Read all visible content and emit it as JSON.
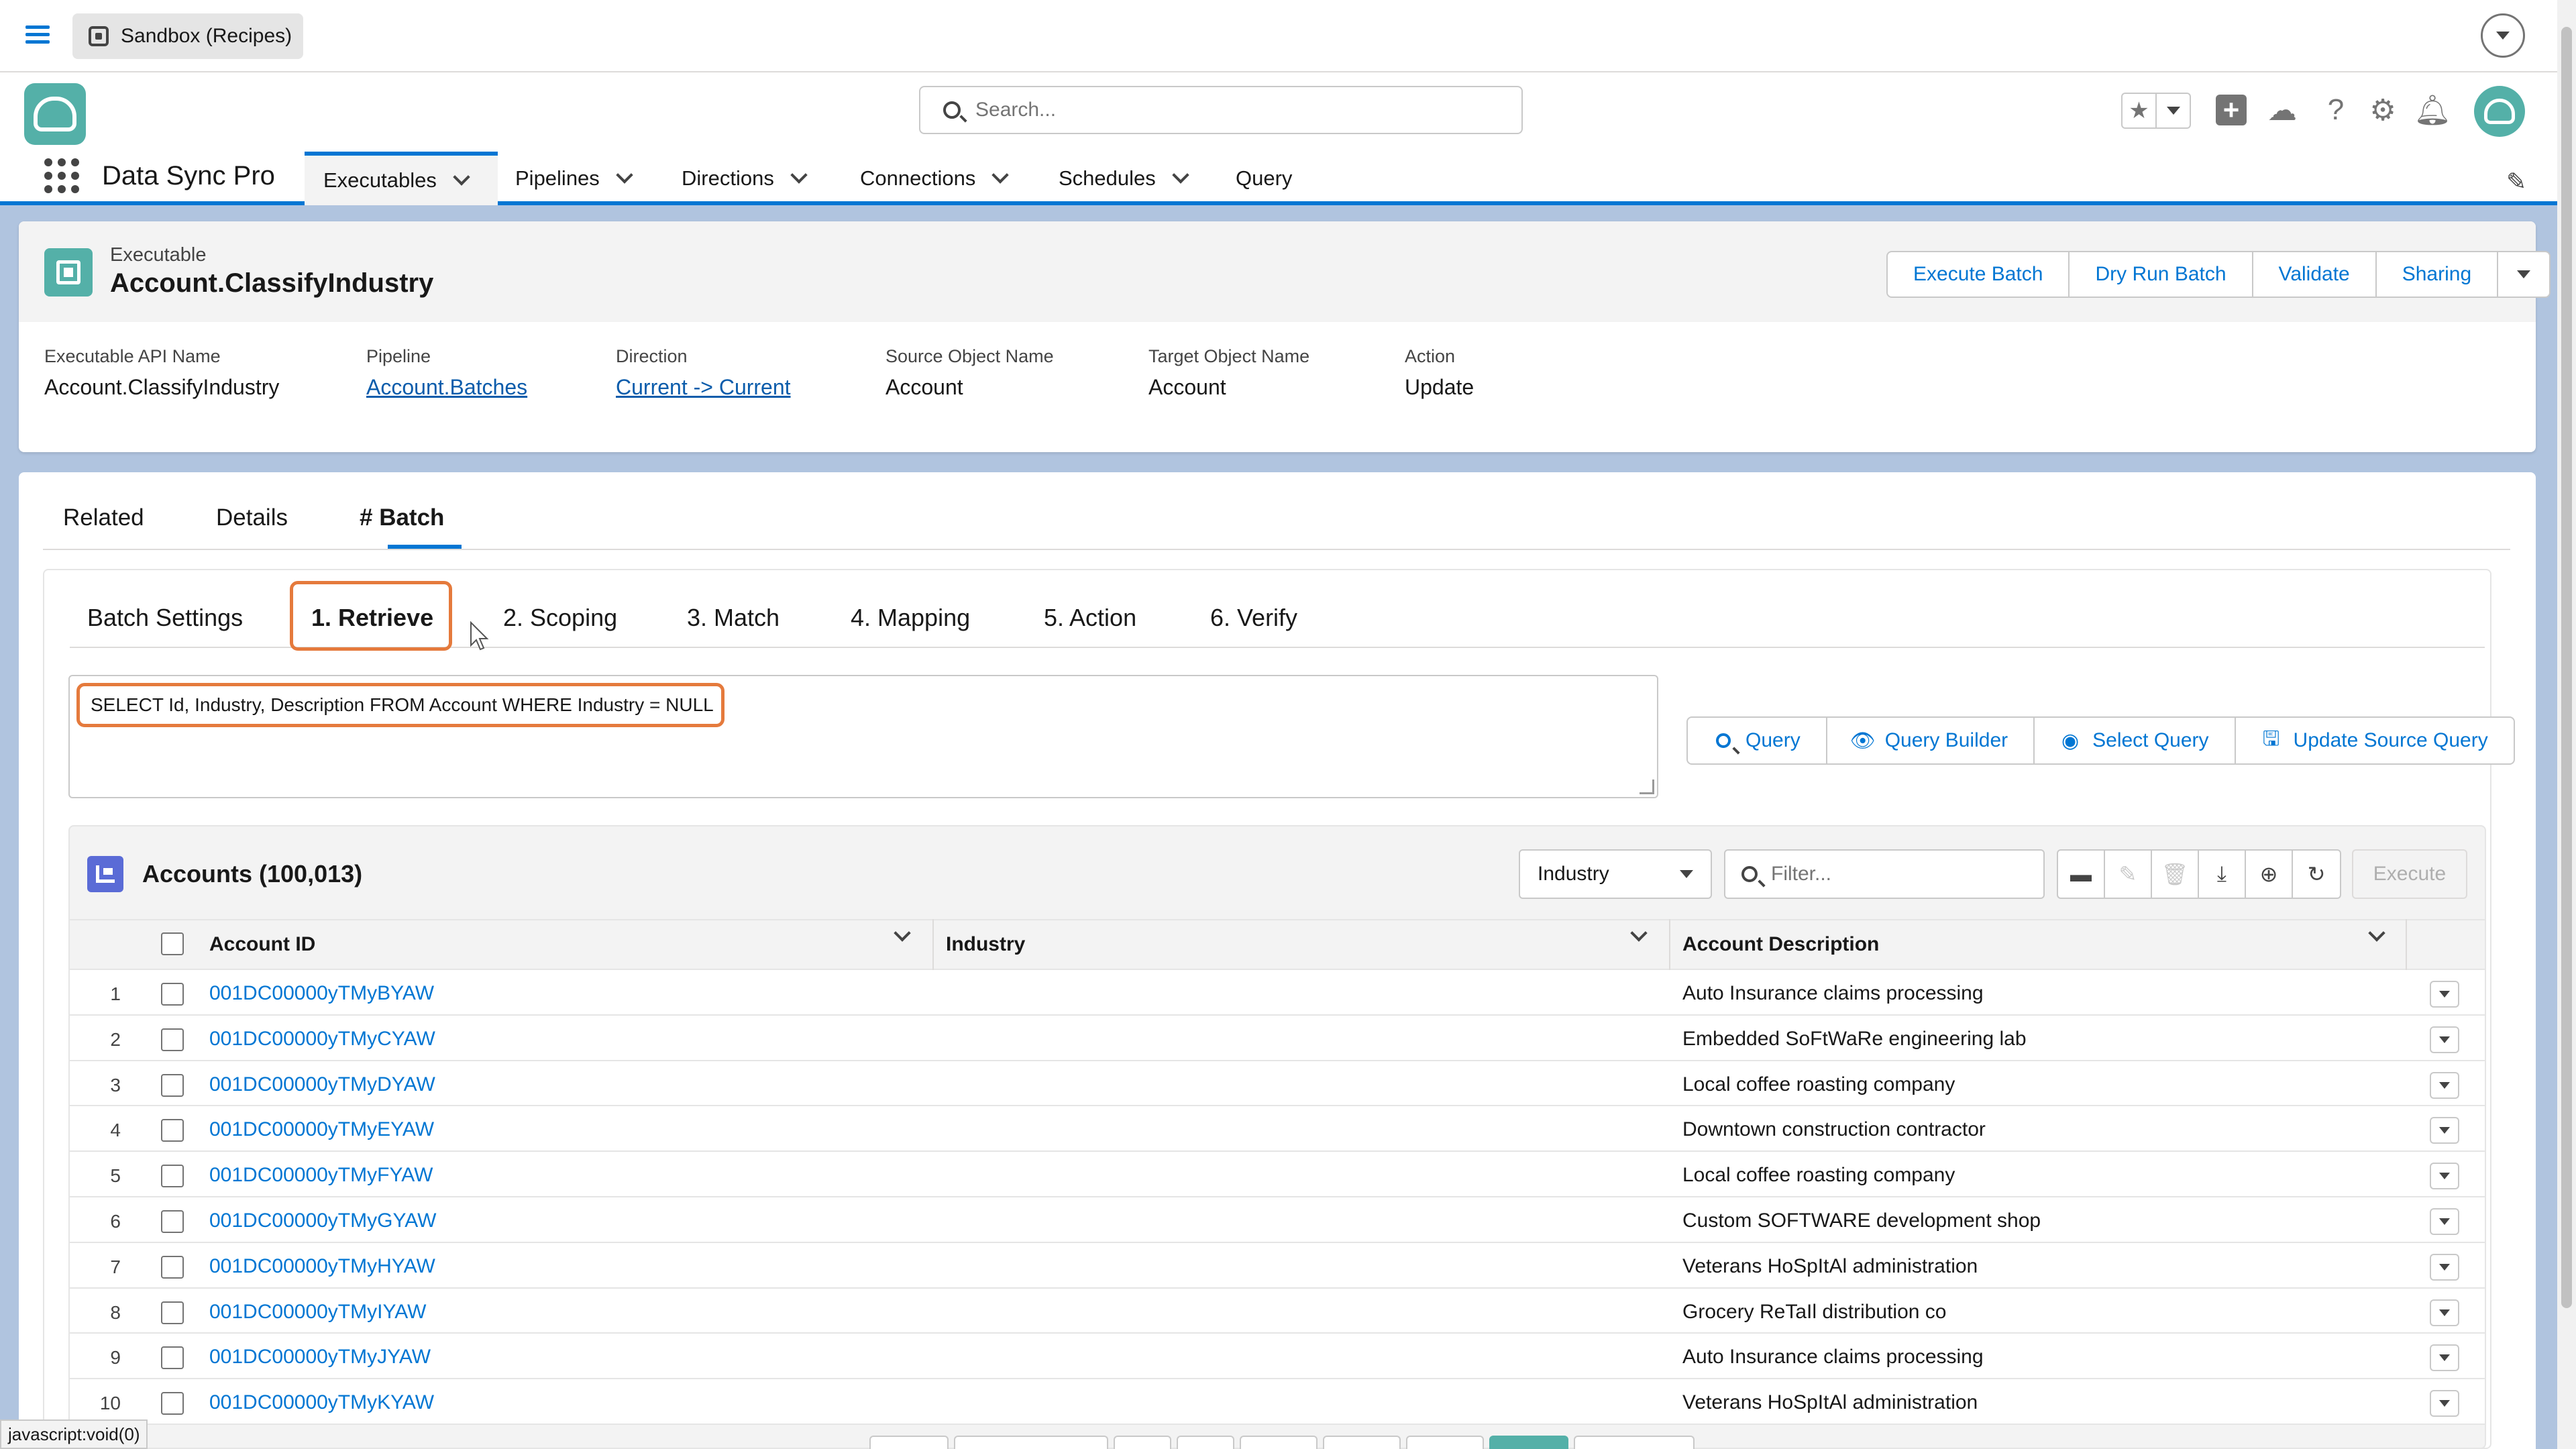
{
  "system_bar": {
    "sandbox_label": "Sandbox (Recipes)"
  },
  "header": {
    "search_placeholder": "Search..."
  },
  "app_nav": {
    "app_name": "Data Sync Pro",
    "items": [
      {
        "label": "Executables",
        "active": true,
        "has_dropdown": true
      },
      {
        "label": "Pipelines",
        "has_dropdown": true
      },
      {
        "label": "Directions",
        "has_dropdown": true
      },
      {
        "label": "Connections",
        "has_dropdown": true
      },
      {
        "label": "Schedules",
        "has_dropdown": true
      },
      {
        "label": "Query",
        "has_dropdown": false
      }
    ]
  },
  "record": {
    "type_label": "Executable",
    "title": "Account.ClassifyIndustry",
    "actions": [
      "Execute Batch",
      "Dry Run Batch",
      "Validate",
      "Sharing"
    ],
    "fields": [
      {
        "label": "Executable API Name",
        "value": "Account.ClassifyIndustry",
        "link": false
      },
      {
        "label": "Pipeline",
        "value": "Account.Batches",
        "link": true
      },
      {
        "label": "Direction",
        "value": "Current -> Current",
        "link": true
      },
      {
        "label": "Source Object Name",
        "value": "Account",
        "link": false
      },
      {
        "label": "Target Object Name",
        "value": "Account",
        "link": false
      },
      {
        "label": "Action",
        "value": "Update",
        "link": false
      }
    ]
  },
  "tabs": [
    {
      "label": "Related"
    },
    {
      "label": "Details"
    },
    {
      "label": "# Batch",
      "active": true
    }
  ],
  "sub_tabs": [
    {
      "label": "Batch Settings"
    },
    {
      "label": "1. Retrieve",
      "active": true
    },
    {
      "label": "2. Scoping"
    },
    {
      "label": "3. Match"
    },
    {
      "label": "4. Mapping"
    },
    {
      "label": "5. Action"
    },
    {
      "label": "6. Verify"
    }
  ],
  "query": {
    "text": "SELECT Id, Industry, Description FROM Account WHERE Industry = NULL",
    "buttons": [
      "Query",
      "Query Builder",
      "Select Query",
      "Update Source Query"
    ]
  },
  "table": {
    "title": "Accounts (100,013)",
    "field_selector": "Industry",
    "filter_placeholder": "Filter...",
    "execute_label": "Execute",
    "columns": [
      "Account ID",
      "Industry",
      "Account Description"
    ],
    "rows": [
      {
        "n": "1",
        "id": "001DC00000yTMyBYAW",
        "industry": "",
        "desc": "Auto Insurance claims processing"
      },
      {
        "n": "2",
        "id": "001DC00000yTMyCYAW",
        "industry": "",
        "desc": "Embedded SoFtWaRe engineering lab"
      },
      {
        "n": "3",
        "id": "001DC00000yTMyDYAW",
        "industry": "",
        "desc": "Local coffee roasting company"
      },
      {
        "n": "4",
        "id": "001DC00000yTMyEYAW",
        "industry": "",
        "desc": "Downtown construction contractor"
      },
      {
        "n": "5",
        "id": "001DC00000yTMyFYAW",
        "industry": "",
        "desc": "Local coffee roasting company"
      },
      {
        "n": "6",
        "id": "001DC00000yTMyGYAW",
        "industry": "",
        "desc": "Custom SOFTWARE development shop"
      },
      {
        "n": "7",
        "id": "001DC00000yTMyHYAW",
        "industry": "",
        "desc": "Veterans HoSpItAl administration"
      },
      {
        "n": "8",
        "id": "001DC00000yTMyIYAW",
        "industry": "",
        "desc": "Grocery ReTaIl distribution co"
      },
      {
        "n": "9",
        "id": "001DC00000yTMyJYAW",
        "industry": "",
        "desc": "Auto Insurance claims processing"
      },
      {
        "n": "10",
        "id": "001DC00000yTMyKYAW",
        "industry": "",
        "desc": "Veterans HoSpItAl administration"
      }
    ]
  },
  "status_bar": "javascript:void(0)",
  "colors": {
    "brand_blue": "#0176d3",
    "highlight_orange": "#e57a3c",
    "teal": "#54b0a8"
  }
}
